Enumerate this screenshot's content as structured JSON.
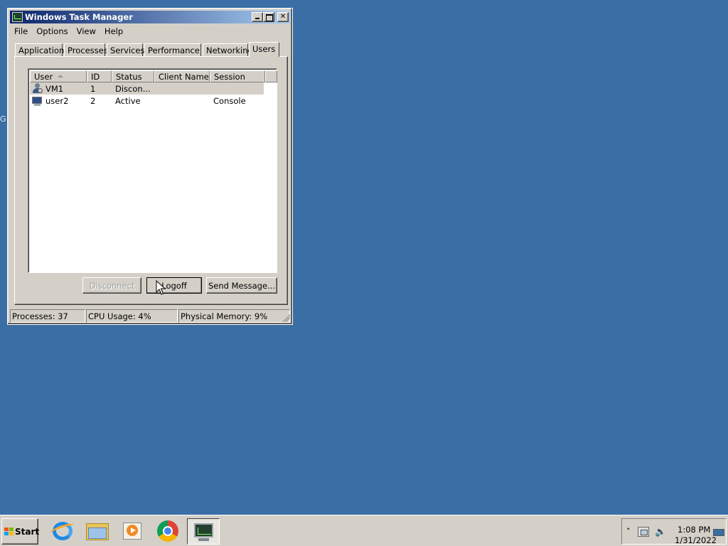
{
  "desktop": {
    "edge_glyph": "G"
  },
  "window": {
    "title": "Windows Task Manager",
    "menu": [
      "File",
      "Options",
      "View",
      "Help"
    ],
    "tabs": [
      "Applications",
      "Processes",
      "Services",
      "Performance",
      "Networking",
      "Users"
    ],
    "active_tab": "Users",
    "users_table": {
      "columns": [
        "User",
        "ID",
        "Status",
        "Client Name",
        "Session"
      ],
      "sort_column": "User",
      "rows": [
        {
          "user": "VM1",
          "id": "1",
          "status": "Discon...",
          "client_name": "",
          "session": "",
          "selected": true,
          "icon": "disconnected-user-icon"
        },
        {
          "user": "user2",
          "id": "2",
          "status": "Active",
          "client_name": "",
          "session": "Console",
          "selected": false,
          "icon": "console-user-icon"
        }
      ]
    },
    "buttons": {
      "disconnect": "Disconnect",
      "logoff": "Logoff",
      "send_message": "Send Message..."
    },
    "status": {
      "processes": "Processes: 37",
      "cpu": "CPU Usage: 4%",
      "memory": "Physical Memory: 9%"
    }
  },
  "taskbar": {
    "start_label": "Start",
    "pinned": [
      "internet-explorer-icon",
      "windows-explorer-icon",
      "media-player-icon",
      "chrome-icon",
      "task-manager-icon"
    ],
    "clock": {
      "time": "1:08 PM",
      "date": "1/31/2022"
    }
  },
  "colors": {
    "desktop": "#3a6ea5",
    "titlebar_start": "#0a246a",
    "titlebar_end": "#a6caf0",
    "chrome_face": "#d4d0c8"
  }
}
